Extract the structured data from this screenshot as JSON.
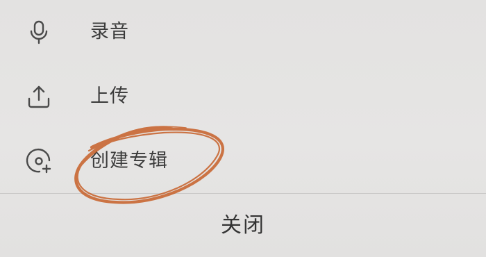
{
  "menu": {
    "items": [
      {
        "label": "录音",
        "icon": "microphone-icon"
      },
      {
        "label": "上传",
        "icon": "upload-icon"
      },
      {
        "label": "创建专辑",
        "icon": "create-album-icon"
      }
    ]
  },
  "close_label": "关闭",
  "colors": {
    "background": "#e5e4e3",
    "text": "#3b3b3b",
    "icon": "#4a4a4a",
    "divider": "#c9c8c7",
    "annotation_circle": "#c8642e"
  },
  "annotation": {
    "shape": "hand-drawn ellipse",
    "target": "创建专辑"
  }
}
